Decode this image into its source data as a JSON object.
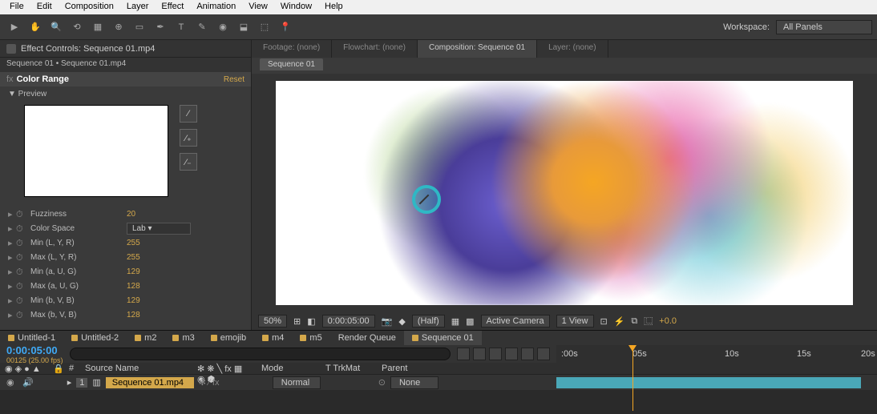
{
  "menu": [
    "File",
    "Edit",
    "Composition",
    "Layer",
    "Effect",
    "Animation",
    "View",
    "Window",
    "Help"
  ],
  "workspace": {
    "label": "Workspace:",
    "value": "All Panels"
  },
  "effectPanel": {
    "title": "Effect Controls: Sequence 01.mp4",
    "breadcrumb": "Sequence 01 • Sequence 01.mp4",
    "effectName": "Color Range",
    "reset": "Reset",
    "previewLabel": "▼ Preview",
    "params": [
      {
        "name": "Fuzziness",
        "value": "20"
      },
      {
        "name": "Color Space",
        "value": "Lab",
        "dropdown": true
      },
      {
        "name": "Min (L, Y, R)",
        "value": "255"
      },
      {
        "name": "Max (L, Y, R)",
        "value": "255"
      },
      {
        "name": "Min (a, U, G)",
        "value": "129"
      },
      {
        "name": "Max (a, U, G)",
        "value": "128"
      },
      {
        "name": "Min (b, V, B)",
        "value": "129"
      },
      {
        "name": "Max (b, V, B)",
        "value": "128"
      }
    ]
  },
  "compTabs": [
    {
      "label": "Footage: (none)"
    },
    {
      "label": "Flowchart: (none)"
    },
    {
      "label": "Composition: Sequence 01",
      "active": true
    },
    {
      "label": "Layer: (none)"
    }
  ],
  "subTab": "Sequence 01",
  "viewControls": {
    "zoom": "50%",
    "time": "0:00:05:00",
    "res": "(Half)",
    "camera": "Active Camera",
    "views": "1 View",
    "exposure": "+0.0"
  },
  "timelineTabs": [
    {
      "label": "Untitled-1"
    },
    {
      "label": "Untitled-2"
    },
    {
      "label": "m2"
    },
    {
      "label": "m3"
    },
    {
      "label": "emojib"
    },
    {
      "label": "m4"
    },
    {
      "label": "m5"
    },
    {
      "label": "Render Queue",
      "nodot": true
    },
    {
      "label": "Sequence 01",
      "active": true
    }
  ],
  "timecode": "0:00:05:00",
  "fps": "00125 (25.00 fps)",
  "columns": [
    "Source Name",
    "Mode",
    "T TrkMat",
    "Parent"
  ],
  "ruler": {
    "marks": [
      ":00s",
      "05s",
      "10s",
      "15s",
      "20s"
    ]
  },
  "layer": {
    "num": "1",
    "name": "Sequence 01.mp4",
    "mode": "Normal",
    "parent": "None"
  }
}
